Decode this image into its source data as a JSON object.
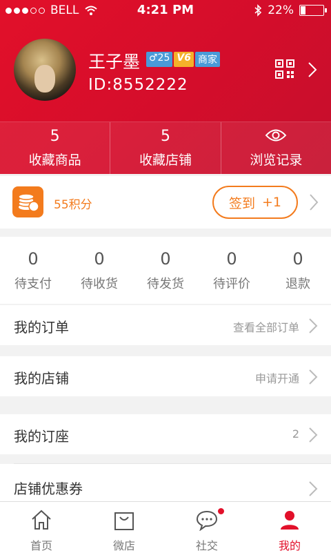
{
  "status_bar": {
    "carrier": "BELL",
    "time": "4:21 PM",
    "battery": "22%",
    "battery_level": 0.22
  },
  "profile": {
    "name": "王子墨",
    "age_badge": "♂25",
    "vip_badge": "V6",
    "shop_badge": "商家",
    "id": "ID:8552222",
    "qr_icon": "qr-code-icon",
    "chevron_icon": "chevron-right-icon"
  },
  "stats": [
    {
      "value": "5",
      "label": "收藏商品"
    },
    {
      "value": "5",
      "label": "收藏店铺"
    },
    {
      "value": "",
      "label": "浏览记录",
      "icon": "eye-icon"
    }
  ],
  "points": {
    "text": "55积分",
    "signin_label": "签到",
    "signin_bonus": "+1",
    "icon": "coins-icon"
  },
  "orders": [
    {
      "count": "0",
      "label": "待支付"
    },
    {
      "count": "0",
      "label": "待收货"
    },
    {
      "count": "0",
      "label": "待发货"
    },
    {
      "count": "0",
      "label": "待评价"
    },
    {
      "count": "0",
      "label": "退款"
    }
  ],
  "menu": {
    "my_orders": {
      "title": "我的订单",
      "right": "查看全部订单"
    },
    "my_shop": {
      "title": "我的店铺",
      "right": "申请开通"
    },
    "my_seats": {
      "title": "我的订座",
      "right": "2"
    },
    "coupons": {
      "title": "店铺优惠券",
      "right": ""
    }
  },
  "tabs": [
    {
      "label": "首页",
      "icon": "home-icon"
    },
    {
      "label": "微店",
      "icon": "shopping-bag-icon"
    },
    {
      "label": "社交",
      "icon": "chat-bubble-icon"
    },
    {
      "label": "我的",
      "icon": "person-icon"
    }
  ],
  "colors": {
    "brand_red": "#e2102a",
    "accent_orange": "#f37b1d",
    "badge_blue": "#4a9bd8",
    "badge_gold": "#f5b02a"
  }
}
